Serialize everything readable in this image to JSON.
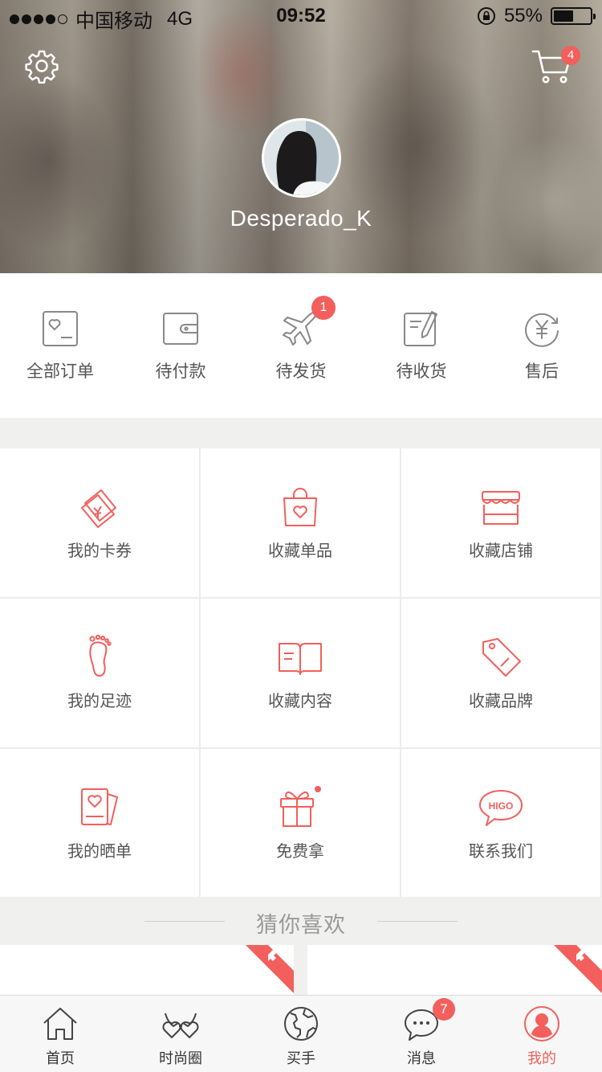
{
  "status_bar": {
    "carrier": "中国移动",
    "network": "4G",
    "time": "09:52",
    "battery": "55%",
    "battery_level": 0.55,
    "signal_bars": 4,
    "signal_total": 5
  },
  "header": {
    "settings_icon": "gear-icon",
    "cart_icon": "cart-icon",
    "cart_count": "4",
    "username": "Desperado_K"
  },
  "orders": {
    "items": [
      {
        "label": "全部订单",
        "icon": "order-heart-icon"
      },
      {
        "label": "待付款",
        "icon": "wallet-icon"
      },
      {
        "label": "待发货",
        "icon": "airplane-icon",
        "badge": "1"
      },
      {
        "label": "待收货",
        "icon": "receive-note-icon"
      },
      {
        "label": "售后",
        "icon": "yuan-refresh-icon"
      }
    ]
  },
  "grid": {
    "items": [
      {
        "label": "我的卡券",
        "icon": "coupon-icon"
      },
      {
        "label": "收藏单品",
        "icon": "bag-heart-icon"
      },
      {
        "label": "收藏店铺",
        "icon": "store-icon"
      },
      {
        "label": "我的足迹",
        "icon": "footprint-icon"
      },
      {
        "label": "收藏内容",
        "icon": "open-book-icon"
      },
      {
        "label": "收藏品牌",
        "icon": "tag-icon"
      },
      {
        "label": "我的晒单",
        "icon": "photo-cards-icon"
      },
      {
        "label": "免费拿",
        "icon": "gift-icon"
      },
      {
        "label": "联系我们",
        "icon": "higo-chat-icon",
        "icon_text": "HIGO"
      }
    ]
  },
  "guess": {
    "title": "猜你喜欢"
  },
  "tabbar": {
    "items": [
      {
        "label": "首页",
        "icon": "home-icon"
      },
      {
        "label": "时尚圈",
        "icon": "glasses-heart-icon"
      },
      {
        "label": "买手",
        "icon": "globe-icon"
      },
      {
        "label": "消息",
        "icon": "chat-bubble-icon",
        "badge": "7"
      },
      {
        "label": "我的",
        "icon": "user-icon",
        "active": true
      }
    ]
  },
  "colors": {
    "accent": "#f25f5c",
    "text": "#555555",
    "background": "#f0f0ee"
  }
}
